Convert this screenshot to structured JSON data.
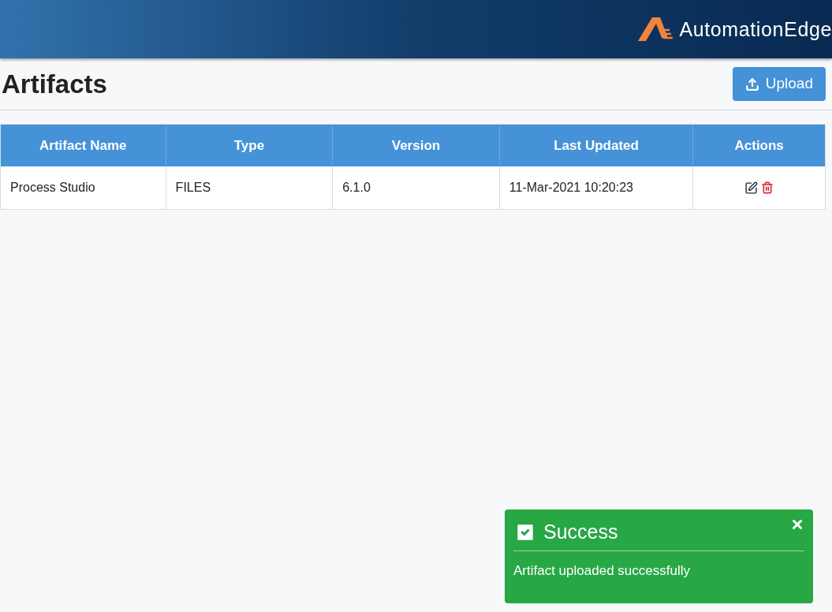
{
  "header": {
    "logo_text": "AutomationEdge"
  },
  "page": {
    "title": "Artifacts",
    "upload_button": "Upload"
  },
  "table": {
    "columns": [
      "Artifact Name",
      "Type",
      "Version",
      "Last Updated",
      "Actions"
    ],
    "rows": [
      {
        "cells": [
          "Process Studio",
          "FILES",
          "6.1.0",
          "11-Mar-2021 10:20:23"
        ]
      }
    ]
  },
  "toast": {
    "title": "Success",
    "message": "Artifact uploaded successfully"
  }
}
